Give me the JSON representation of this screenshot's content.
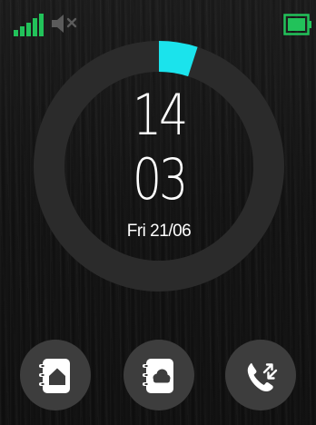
{
  "status": {
    "signal_bars": 5,
    "signal_icon": "signal-bars-icon",
    "sound_icon": "speaker-muted-icon",
    "battery_icon": "battery-full-icon",
    "battery_level": 1.0,
    "accent_color": "#22c25a"
  },
  "clock": {
    "hour": "14",
    "minute": "03",
    "date": "Fri 21/06",
    "seconds_progress": 0.05,
    "progress_color": "#1be3ec",
    "ring_color": "#2b2b2b"
  },
  "dock": [
    {
      "icon": "home-contacts-book-icon"
    },
    {
      "icon": "cloud-contacts-book-icon"
    },
    {
      "icon": "call-log-icon"
    }
  ]
}
